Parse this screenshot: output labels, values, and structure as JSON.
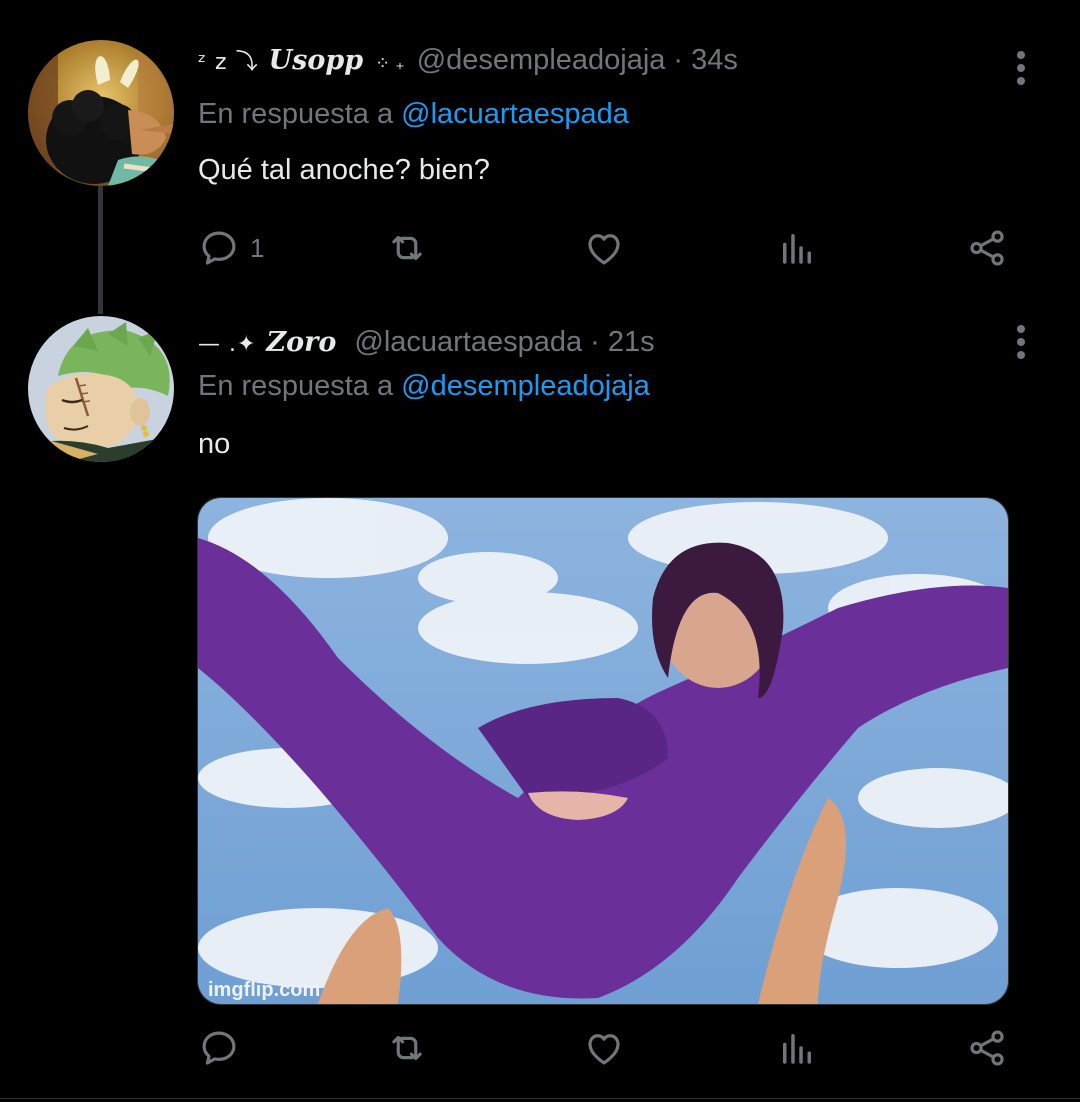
{
  "tweets": [
    {
      "display_name": "Usopp",
      "name_prefix": "ᶻ z ⤵",
      "name_suffix": "⁘ ₊",
      "handle": "@desempleadojaja",
      "time": "34s",
      "reply_label": "En respuesta a",
      "reply_to": "@lacuartaespada",
      "text": "Qué tal anoche? bien?",
      "reply_count": "1",
      "avatar_icon": "usopp-avatar"
    },
    {
      "display_name": "Zoro",
      "name_prefix": "— .✦",
      "handle": "@lacuartaespada",
      "time": "21s",
      "reply_label": "En respuesta a",
      "reply_to": "@desempleadojaja",
      "text": "no",
      "reply_count": "",
      "media": {
        "watermark": "imgflip.com"
      },
      "avatar_icon": "zoro-avatar"
    }
  ],
  "separator": "·",
  "icons": {
    "reply": "reply-icon",
    "retweet": "retweet-icon",
    "like": "like-icon",
    "analytics": "analytics-icon",
    "share": "share-icon",
    "more": "more-icon"
  },
  "colors": {
    "background": "#000000",
    "text": "#e7e9ea",
    "muted": "#71767b",
    "link": "#1d9bf0"
  }
}
